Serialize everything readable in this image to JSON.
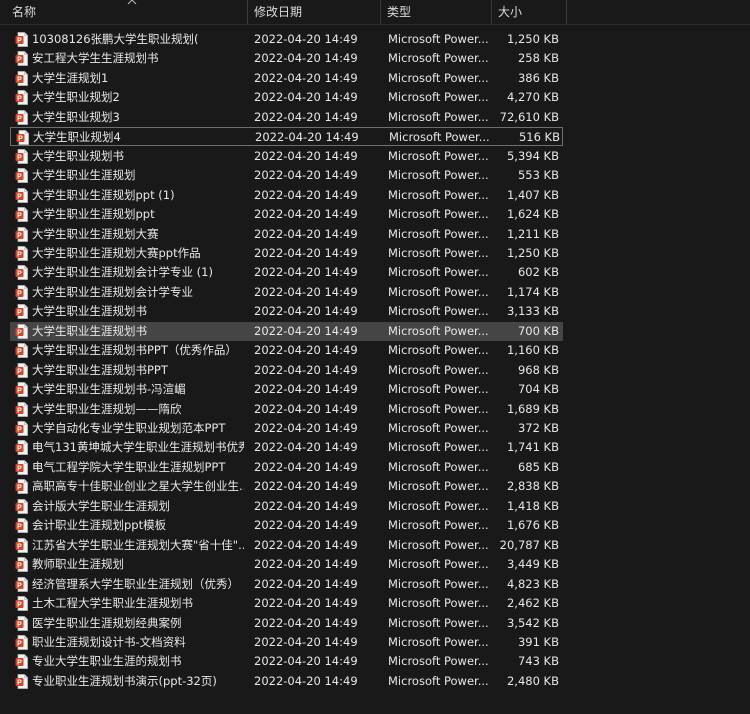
{
  "columns": {
    "name": "名称",
    "date": "修改日期",
    "type": "类型",
    "size": "大小"
  },
  "accent": {
    "ppt_icon": "#d24726",
    "selection": "#454545",
    "focus_border": "#6f6f6f"
  },
  "icon": "powerpoint-file-icon",
  "files": [
    {
      "name": "10308126张鹏大学生职业规划(",
      "date": "2022-04-20 14:49",
      "type": "Microsoft Power...",
      "size": "1,250 KB"
    },
    {
      "name": "安工程大学生生涯规划书",
      "date": "2022-04-20 14:49",
      "type": "Microsoft Power...",
      "size": "258 KB"
    },
    {
      "name": "大学生涯规划1",
      "date": "2022-04-20 14:49",
      "type": "Microsoft Power...",
      "size": "386 KB"
    },
    {
      "name": "大学生职业规划2",
      "date": "2022-04-20 14:49",
      "type": "Microsoft Power...",
      "size": "4,270 KB"
    },
    {
      "name": "大学生职业规划3",
      "date": "2022-04-20 14:49",
      "type": "Microsoft Power...",
      "size": "72,610 KB"
    },
    {
      "name": "大学生职业规划4",
      "date": "2022-04-20 14:49",
      "type": "Microsoft Power...",
      "size": "516 KB",
      "state": "focus"
    },
    {
      "name": "大学生职业规划书",
      "date": "2022-04-20 14:49",
      "type": "Microsoft Power...",
      "size": "5,394 KB"
    },
    {
      "name": "大学生职业生涯规划",
      "date": "2022-04-20 14:49",
      "type": "Microsoft Power...",
      "size": "553 KB"
    },
    {
      "name": "大学生职业生涯规划ppt (1)",
      "date": "2022-04-20 14:49",
      "type": "Microsoft Power...",
      "size": "1,407 KB"
    },
    {
      "name": "大学生职业生涯规划ppt",
      "date": "2022-04-20 14:49",
      "type": "Microsoft Power...",
      "size": "1,624 KB"
    },
    {
      "name": "大学生职业生涯规划大赛",
      "date": "2022-04-20 14:49",
      "type": "Microsoft Power...",
      "size": "1,211 KB"
    },
    {
      "name": "大学生职业生涯规划大赛ppt作品",
      "date": "2022-04-20 14:49",
      "type": "Microsoft Power...",
      "size": "1,250 KB"
    },
    {
      "name": "大学生职业生涯规划会计学专业 (1)",
      "date": "2022-04-20 14:49",
      "type": "Microsoft Power...",
      "size": "602 KB"
    },
    {
      "name": "大学生职业生涯规划会计学专业",
      "date": "2022-04-20 14:49",
      "type": "Microsoft Power...",
      "size": "1,174 KB"
    },
    {
      "name": "大学生职业生涯规划书",
      "date": "2022-04-20 14:49",
      "type": "Microsoft Power...",
      "size": "3,133 KB"
    },
    {
      "name": "大学生职业生涯规划书",
      "date": "2022-04-20 14:49",
      "type": "Microsoft Power...",
      "size": "700 KB",
      "state": "selected"
    },
    {
      "name": "大学生职业生涯规划书PPT（优秀作品）",
      "date": "2022-04-20 14:49",
      "type": "Microsoft Power...",
      "size": "1,160 KB"
    },
    {
      "name": "大学生职业生涯规划书PPT",
      "date": "2022-04-20 14:49",
      "type": "Microsoft Power...",
      "size": "968 KB"
    },
    {
      "name": "大学生职业生涯规划书-冯渲嵋",
      "date": "2022-04-20 14:49",
      "type": "Microsoft Power...",
      "size": "704 KB"
    },
    {
      "name": "大学生职业生涯规划——隋欣",
      "date": "2022-04-20 14:49",
      "type": "Microsoft Power...",
      "size": "1,689 KB"
    },
    {
      "name": "大学自动化专业学生职业规划范本PPT",
      "date": "2022-04-20 14:49",
      "type": "Microsoft Power...",
      "size": "372 KB"
    },
    {
      "name": "电气131黄坤城大学生职业生涯规划书优秀",
      "date": "2022-04-20 14:49",
      "type": "Microsoft Power...",
      "size": "1,741 KB"
    },
    {
      "name": "电气工程学院大学生职业生涯规划PPT",
      "date": "2022-04-20 14:49",
      "type": "Microsoft Power...",
      "size": "685 KB"
    },
    {
      "name": "高职高专十佳职业创业之星大学生创业生...",
      "date": "2022-04-20 14:49",
      "type": "Microsoft Power...",
      "size": "2,838 KB"
    },
    {
      "name": "会计版大学生职业生涯规划",
      "date": "2022-04-20 14:49",
      "type": "Microsoft Power...",
      "size": "1,418 KB"
    },
    {
      "name": "会计职业生涯规划ppt模板",
      "date": "2022-04-20 14:49",
      "type": "Microsoft Power...",
      "size": "1,676 KB"
    },
    {
      "name": "江苏省大学生职业生涯规划大赛\"省十佳\"...",
      "date": "2022-04-20 14:49",
      "type": "Microsoft Power...",
      "size": "20,787 KB"
    },
    {
      "name": "教师职业生涯规划",
      "date": "2022-04-20 14:49",
      "type": "Microsoft Power...",
      "size": "3,449 KB"
    },
    {
      "name": "经济管理系大学生职业生涯规划（优秀）",
      "date": "2022-04-20 14:49",
      "type": "Microsoft Power...",
      "size": "4,823 KB"
    },
    {
      "name": "土木工程大学生职业生涯规划书",
      "date": "2022-04-20 14:49",
      "type": "Microsoft Power...",
      "size": "2,462 KB"
    },
    {
      "name": "医学生职业生涯规划经典案例",
      "date": "2022-04-20 14:49",
      "type": "Microsoft Power...",
      "size": "3,542 KB"
    },
    {
      "name": "职业生涯规划设计书-文档资料",
      "date": "2022-04-20 14:49",
      "type": "Microsoft Power...",
      "size": "391 KB"
    },
    {
      "name": "专业大学生职业生涯的规划书",
      "date": "2022-04-20 14:49",
      "type": "Microsoft Power...",
      "size": "743 KB"
    },
    {
      "name": "专业职业生涯规划书演示(ppt-32页)",
      "date": "2022-04-20 14:49",
      "type": "Microsoft Power...",
      "size": "2,480 KB"
    }
  ]
}
